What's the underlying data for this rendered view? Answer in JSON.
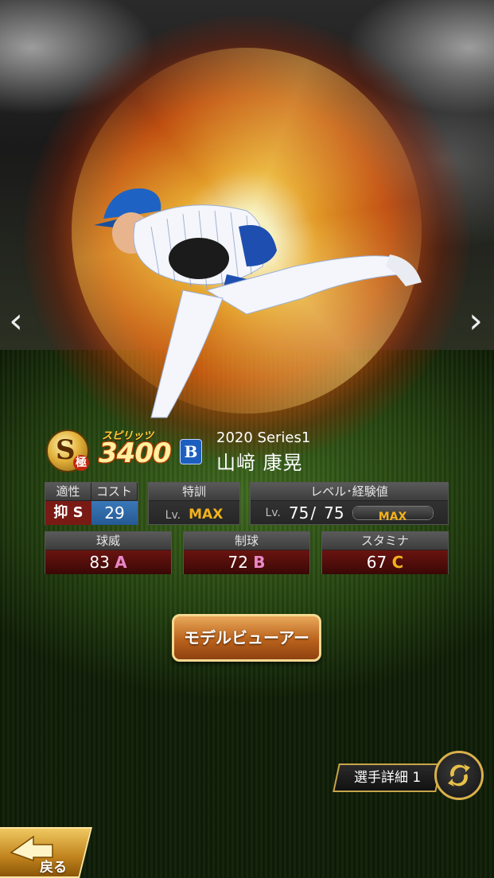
{
  "nav": {
    "prev_arrow": "‹",
    "next_arrow": "›"
  },
  "card": {
    "rank_letter": "S",
    "rank_sub": "極",
    "spirit_label": "スピリッツ",
    "spirit_value": "3400",
    "team_logo": "B",
    "series": "2020 Series1",
    "player_name": "山﨑 康晃"
  },
  "aptitude": {
    "label": "適性",
    "value": "抑 S"
  },
  "cost": {
    "label": "コスト",
    "value": "29"
  },
  "training": {
    "label": "特訓",
    "lv_prefix": "Lv.",
    "value": "MAX"
  },
  "level": {
    "label": "レベル･経験値",
    "lv_prefix": "Lv.",
    "current": "75",
    "separator": "/",
    "max": "75",
    "exp_label": "MAX",
    "exp_fraction": 1.0
  },
  "stats": [
    {
      "label": "球威",
      "value": "83",
      "grade": "A"
    },
    {
      "label": "制球",
      "value": "72",
      "grade": "B"
    },
    {
      "label": "スタミナ",
      "value": "67",
      "grade": "C"
    }
  ],
  "buttons": {
    "model_viewer": "モデルビューアー",
    "player_detail": "選手詳細 1",
    "back": "戻る"
  },
  "colors": {
    "gold": "#f2b21a",
    "stat_red": "#6a1410",
    "cost_blue": "#3a78b8",
    "team_blue": "#1d5fbf"
  },
  "icons": {
    "swap": "swap-arrows-icon",
    "back": "back-arrow-icon"
  }
}
